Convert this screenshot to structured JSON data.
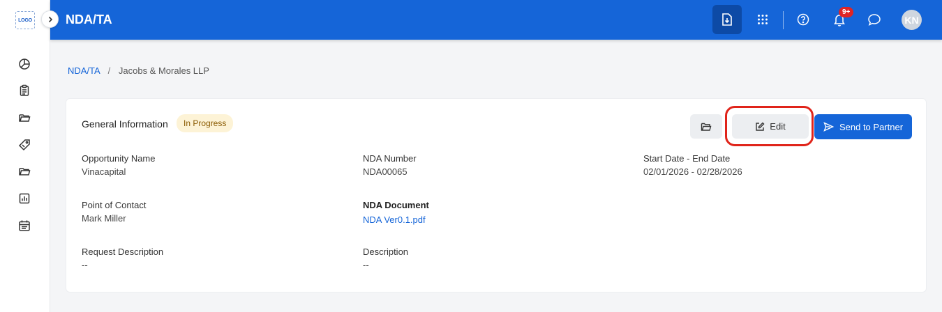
{
  "sidebar": {
    "logo_text": "LOGO",
    "nav_icons": [
      "pie-chart-icon",
      "clipboard-icon",
      "folder-icon",
      "tag-icon",
      "folder-open-icon",
      "report-icon",
      "calendar-icon"
    ]
  },
  "header": {
    "title": "NDA/TA",
    "notification_count": "9+",
    "avatar_initials": "KN",
    "brand_color": "#1565d8"
  },
  "breadcrumb": {
    "root": "NDA/TA",
    "separator": "/",
    "current": "Jacobs & Morales LLP"
  },
  "card": {
    "title": "General Information",
    "status": "In Progress",
    "edit_label": "Edit",
    "send_label": "Send to Partner",
    "fields": {
      "opportunity_name": {
        "label": "Opportunity Name",
        "value": "Vinacapital"
      },
      "nda_number": {
        "label": "NDA Number",
        "value": "NDA00065"
      },
      "date_range": {
        "label": "Start Date - End Date",
        "value": "02/01/2026 - 02/28/2026"
      },
      "point_of_contact": {
        "label": "Point of Contact",
        "value": "Mark Miller"
      },
      "nda_document": {
        "label": "NDA Document",
        "value": "NDA Ver0.1.pdf"
      },
      "request_description": {
        "label": "Request Description",
        "value": "--"
      },
      "description": {
        "label": "Description",
        "value": "--"
      }
    }
  }
}
